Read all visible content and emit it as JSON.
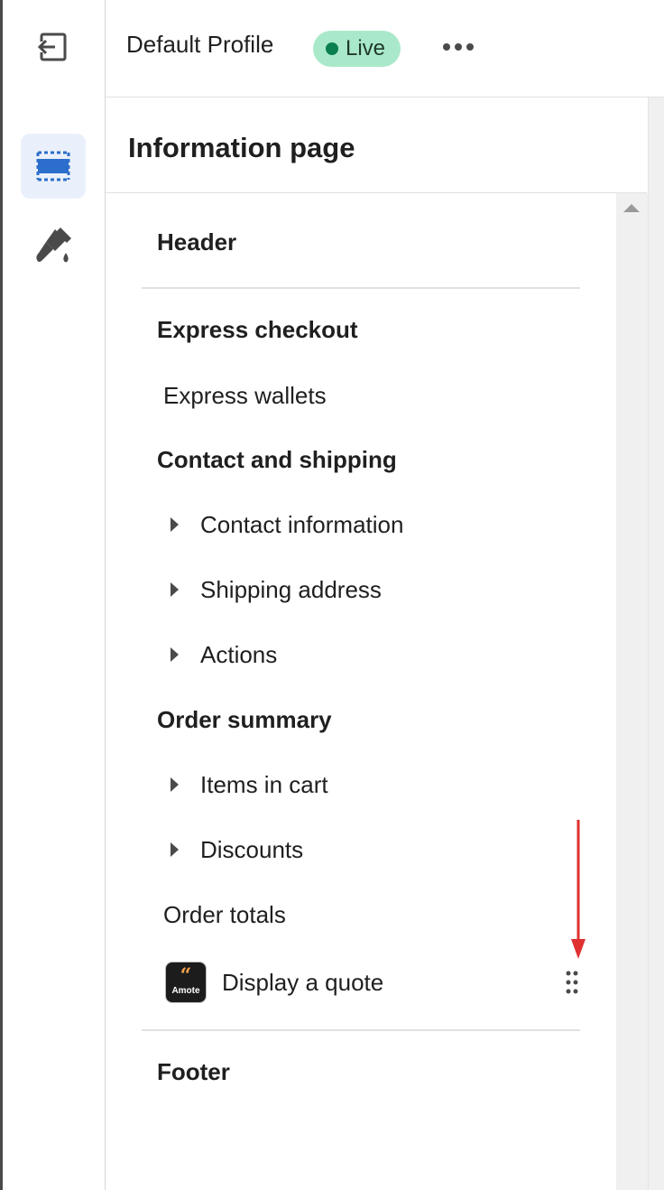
{
  "topbar": {
    "profile_name": "Default Profile",
    "status_label": "Live",
    "status_color": "#a9e9c9",
    "more_icon": "ellipsis-horizontal-icon",
    "exit_icon": "exit-icon"
  },
  "rail": {
    "items": [
      {
        "name": "sections",
        "icon": "layout-sections-icon",
        "active": true
      },
      {
        "name": "styling",
        "icon": "paint-brush-icon",
        "active": false
      }
    ]
  },
  "panel": {
    "title": "Information page"
  },
  "tree": {
    "header": "Header",
    "express_checkout": "Express checkout",
    "express_wallets": "Express wallets",
    "contact_shipping": "Contact and shipping",
    "contact_information": "Contact information",
    "shipping_address": "Shipping address",
    "actions": "Actions",
    "order_summary": "Order summary",
    "items_in_cart": "Items in cart",
    "discounts": "Discounts",
    "order_totals": "Order totals",
    "display_quote": "Display a quote",
    "app_icon_text": "Amote",
    "footer": "Footer"
  },
  "accent_color": "#2c6ecb",
  "annotation_color": "#e03131"
}
